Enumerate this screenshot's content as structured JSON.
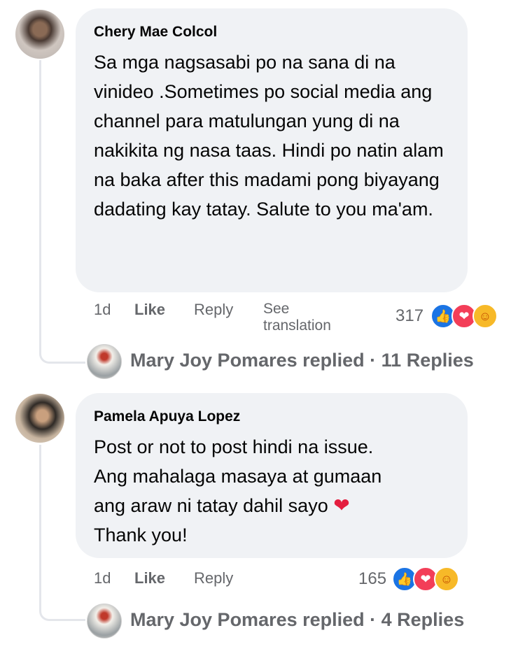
{
  "comments": [
    {
      "author": "Chery Mae Colcol",
      "text": "Sa mga nagsasabi po na sana di na vinideo .Sometimes po social media ang channel para matulungan yung di na nakikita ng nasa taas. Hindi po natin alam na baka after this madami pong biyayang dadating kay tatay. Salute to you ma'am.",
      "time": "1d",
      "like_label": "Like",
      "reply_label": "Reply",
      "see_translation_label": "See translation",
      "reaction_count": "317",
      "reactions": [
        "like-icon",
        "love-icon",
        "care-icon"
      ],
      "replies_summary": "Mary Joy Pomares replied · 11 Replies"
    },
    {
      "author": "Pamela Apuya Lopez",
      "text_lines": [
        "Post or not to post hindi na issue.",
        "Ang mahalaga masaya at gumaan",
        "ang araw ni tatay dahil sayo",
        "Thank you!"
      ],
      "time": "1d",
      "like_label": "Like",
      "reply_label": "Reply",
      "reaction_count": "165",
      "reactions": [
        "like-icon",
        "love-icon",
        "care-icon"
      ],
      "replies_summary": "Mary Joy Pomares replied · 4 Replies"
    }
  ],
  "colors": {
    "bubble": "#f0f2f5",
    "secondary_text": "#65676b",
    "like_blue": "#1b74e4",
    "love_red": "#f33e58",
    "care_yellow": "#f7b928"
  }
}
